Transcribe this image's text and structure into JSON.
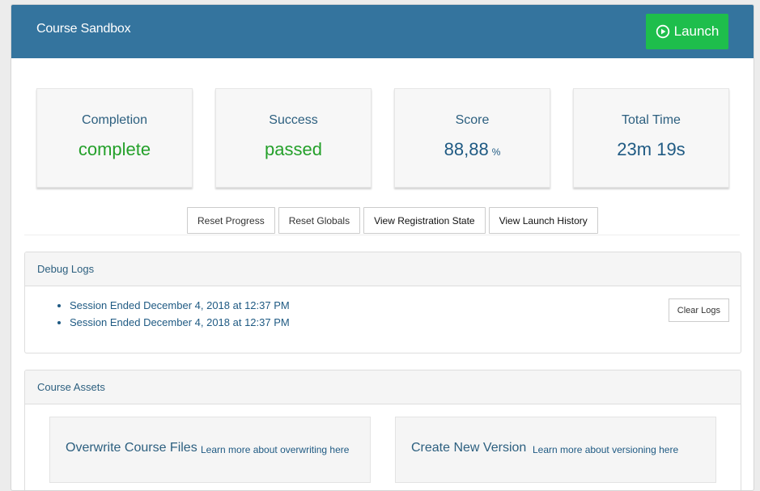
{
  "header": {
    "title": "Course Sandbox",
    "launch_label": "Launch",
    "launch_color": "#1ebe4c",
    "bar_color": "#34749e"
  },
  "stats": [
    {
      "label": "Completion",
      "value": "complete"
    },
    {
      "label": "Success",
      "value": "passed"
    },
    {
      "label": "Score",
      "value": "88,88",
      "unit": "%"
    },
    {
      "label": "Total Time",
      "value": "23m 19s"
    }
  ],
  "actions": {
    "reset_progress": "Reset Progress",
    "reset_globals": "Reset Globals",
    "view_registration_state": "View Registration State",
    "view_launch_history": "View Launch History"
  },
  "debug_logs": {
    "title": "Debug Logs",
    "entries": [
      "Session Ended December 4, 2018 at 12:37 PM",
      "Session Ended December 4, 2018 at 12:37 PM"
    ],
    "clear_label": "Clear Logs"
  },
  "course_assets": {
    "title": "Course Assets",
    "cards": [
      {
        "title": "Overwrite Course Files",
        "link": "Learn more about overwriting here"
      },
      {
        "title": "Create New Version",
        "link": "Learn more about versioning here"
      }
    ]
  },
  "icons": {
    "launch": "play-circle-icon"
  }
}
